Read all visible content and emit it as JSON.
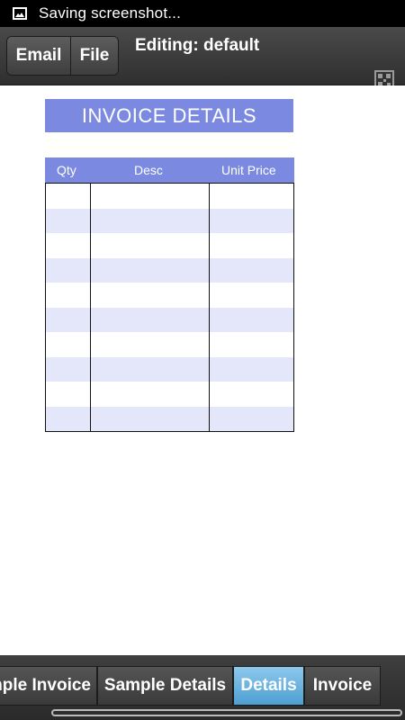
{
  "status_bar": {
    "notification_text": "Saving screenshot...",
    "icon": "image-icon"
  },
  "toolbar": {
    "email_label": "Email",
    "file_label": "File",
    "title": "Editing: default",
    "qr_icon": "qr-code-icon"
  },
  "invoice": {
    "title": "INVOICE DETAILS",
    "columns": [
      "Qty",
      "Desc",
      "Unit Price"
    ],
    "row_count": 10
  },
  "bottom_tabs": {
    "items": [
      {
        "label": "Sample Invoice"
      },
      {
        "label": "Sample Details"
      },
      {
        "label": "Details"
      },
      {
        "label": "Invoice"
      }
    ],
    "active": "Details"
  },
  "colors": {
    "header_blue": "#7b8ae0",
    "stripe": "#e4e7f9",
    "active_tab": "#6fb3e2"
  }
}
